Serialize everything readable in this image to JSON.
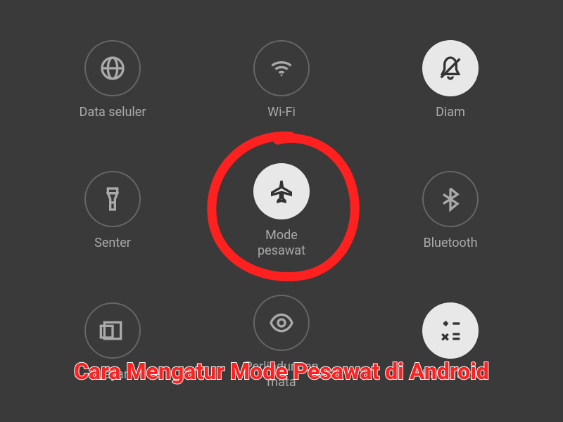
{
  "tiles": {
    "data_seluler": {
      "label": "Data seluler",
      "active": false
    },
    "wifi": {
      "label": "Wi-Fi",
      "active": false
    },
    "diam": {
      "label": "Diam",
      "active": true
    },
    "senter": {
      "label": "Senter",
      "active": false
    },
    "mode_pesawat": {
      "label": "Mode\npesawat",
      "active": true
    },
    "bluetooth": {
      "label": "Bluetooth",
      "active": false
    },
    "layar": {
      "label": "Layar",
      "active": false
    },
    "perlindungan_mata": {
      "label": "Perlindungan\nmata",
      "active": false
    },
    "kalkulator": {
      "label": "Kalkulator",
      "active": true
    }
  },
  "overlay": {
    "title": "Cara Mengatur Mode Pesawat di Android"
  },
  "colors": {
    "background": "#3a3a3a",
    "inactive_border": "#666",
    "active_bg": "#e8e8e8",
    "label_color": "#aaa",
    "annotation_red": "#ff2020"
  }
}
